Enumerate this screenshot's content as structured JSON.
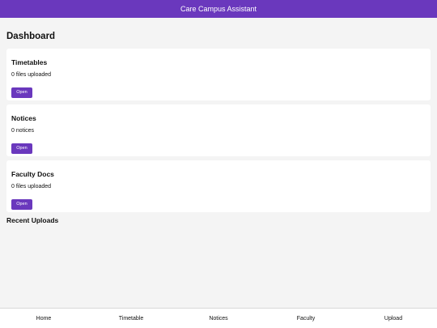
{
  "header": {
    "title": "Care Campus Assistant"
  },
  "dashboard": {
    "title": "Dashboard",
    "cards": [
      {
        "title": "Timetables",
        "subtitle": "0 files uploaded",
        "button": "Open"
      },
      {
        "title": "Notices",
        "subtitle": "0 notices",
        "button": "Open"
      },
      {
        "title": "Faculty Docs",
        "subtitle": "0 files uploaded",
        "button": "Open"
      }
    ],
    "recent_uploads_title": "Recent Uploads"
  },
  "nav": {
    "items": [
      {
        "label": "Home"
      },
      {
        "label": "Timetable"
      },
      {
        "label": "Notices"
      },
      {
        "label": "Faculty"
      },
      {
        "label": "Upload"
      }
    ]
  },
  "colors": {
    "accent": "#6a38bd",
    "background": "#f4f4f4",
    "card": "#ffffff"
  }
}
